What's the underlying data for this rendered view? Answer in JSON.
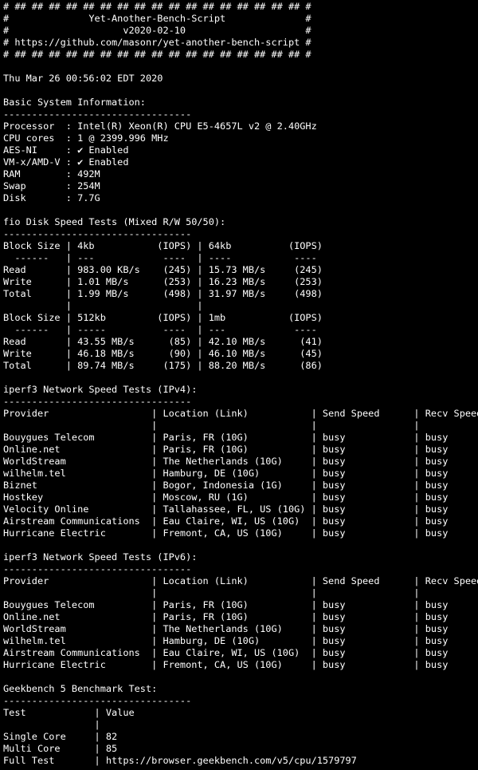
{
  "terminal": {
    "lines": [
      "# ## ## ## ## ## ## ## ## ## ## ## ## ## ## ## ## ## #",
      "#              Yet-Another-Bench-Script              #",
      "#                    v2020-02-10                     #",
      "# https://github.com/masonr/yet-another-bench-script #",
      "# ## ## ## ## ## ## ## ## ## ## ## ## ## ## ## ## ## #",
      "",
      "Thu Mar 26 00:56:02 EDT 2020",
      "",
      "Basic System Information:",
      "---------------------------------",
      "Processor  : Intel(R) Xeon(R) CPU E5-4657L v2 @ 2.40GHz",
      "CPU cores  : 1 @ 2399.996 MHz",
      "AES-NI     : ✔ Enabled",
      "VM-x/AMD-V : ✔ Enabled",
      "RAM        : 492M",
      "Swap       : 254M",
      "Disk       : 7.7G",
      "",
      "fio Disk Speed Tests (Mixed R/W 50/50):",
      "---------------------------------",
      "Block Size | 4kb           (IOPS) | 64kb          (IOPS)",
      "  ------   | ---            ----  | ----           ----",
      "Read       | 983.00 KB/s    (245) | 15.73 MB/s     (245)",
      "Write      | 1.01 MB/s      (253) | 16.23 MB/s     (253)",
      "Total      | 1.99 MB/s      (498) | 31.97 MB/s     (498)",
      "           |                      |",
      "Block Size | 512kb         (IOPS) | 1mb           (IOPS)",
      "  ------   | -----          ----  | ---            ----",
      "Read       | 43.55 MB/s      (85) | 42.10 MB/s      (41)",
      "Write      | 46.18 MB/s      (90) | 46.10 MB/s      (45)",
      "Total      | 89.74 MB/s     (175) | 88.20 MB/s      (86)",
      "",
      "iperf3 Network Speed Tests (IPv4):",
      "---------------------------------",
      "Provider                  | Location (Link)           | Send Speed      | Recv Speed",
      "                          |                           |                 |",
      "Bouygues Telecom          | Paris, FR (10G)           | busy            | busy",
      "Online.net                | Paris, FR (10G)           | busy            | busy",
      "WorldStream               | The Netherlands (10G)     | busy            | busy",
      "wilhelm.tel               | Hamburg, DE (10G)         | busy            | busy",
      "Biznet                    | Bogor, Indonesia (1G)     | busy            | busy",
      "Hostkey                   | Moscow, RU (1G)           | busy            | busy",
      "Velocity Online           | Tallahassee, FL, US (10G) | busy            | busy",
      "Airstream Communications  | Eau Claire, WI, US (10G)  | busy            | busy",
      "Hurricane Electric        | Fremont, CA, US (10G)     | busy            | busy",
      "",
      "iperf3 Network Speed Tests (IPv6):",
      "---------------------------------",
      "Provider                  | Location (Link)           | Send Speed      | Recv Speed",
      "                          |                           |                 |",
      "Bouygues Telecom          | Paris, FR (10G)           | busy            | busy",
      "Online.net                | Paris, FR (10G)           | busy            | busy",
      "WorldStream               | The Netherlands (10G)     | busy            | busy",
      "wilhelm.tel               | Hamburg, DE (10G)         | busy            | busy",
      "Airstream Communications  | Eau Claire, WI, US (10G)  | busy            | busy",
      "Hurricane Electric        | Fremont, CA, US (10G)     | busy            | busy",
      "",
      "Geekbench 5 Benchmark Test:",
      "---------------------------------",
      "Test            | Value",
      "                |",
      "Single Core     | 82",
      "Multi Core      | 85",
      "Full Test       | https://browser.geekbench.com/v5/cpu/1579797"
    ]
  }
}
